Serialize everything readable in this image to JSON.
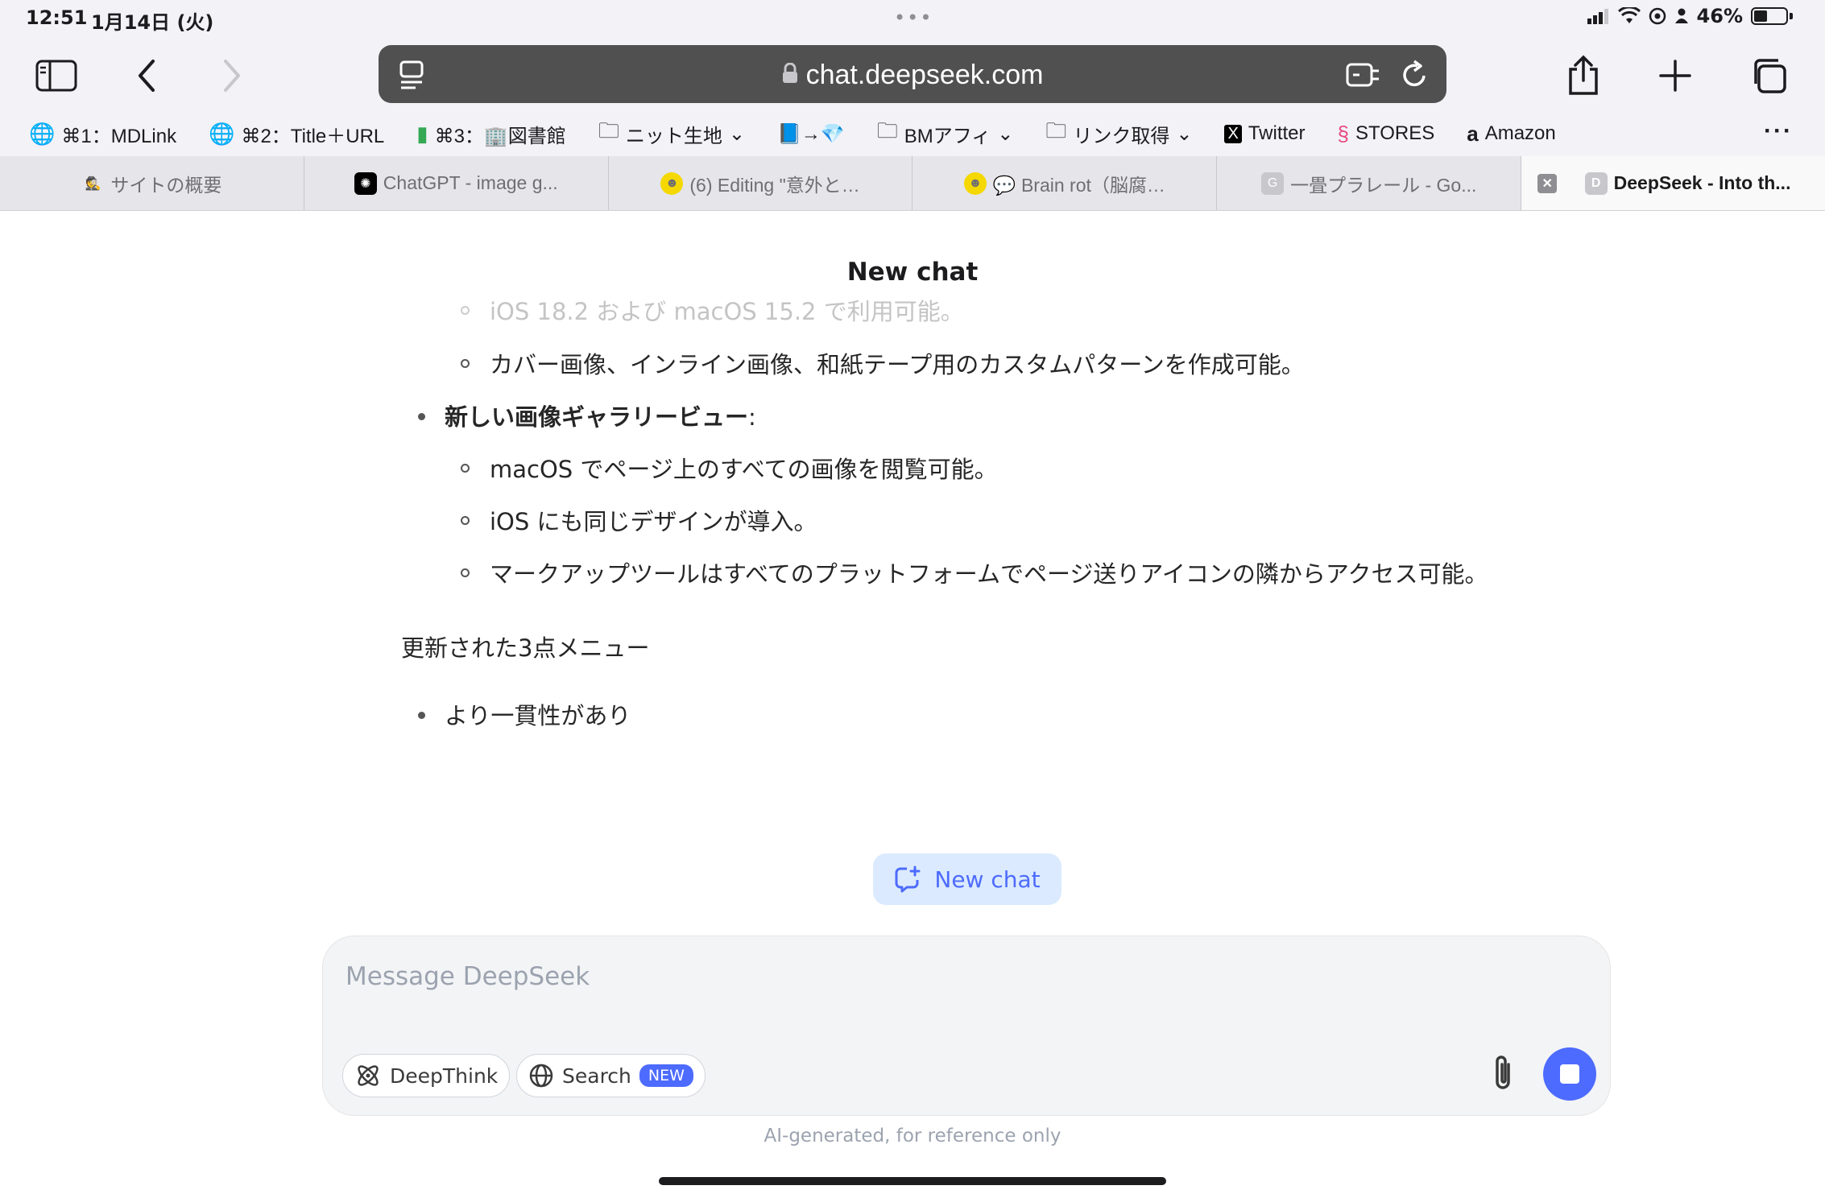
{
  "status": {
    "time": "12:51",
    "date": "1月14日 (火)",
    "dots": "•••",
    "battery_pct": "46%"
  },
  "toolbar": {
    "url": "chat.deepseek.com"
  },
  "bookmarks": [
    {
      "icon": "globe-icon",
      "label": "⌘1：MDLink"
    },
    {
      "icon": "globe-icon",
      "label": "⌘2：Title＋URL"
    },
    {
      "icon": "book-icon",
      "label": "⌘3：🏢図書館"
    },
    {
      "icon": "folder-icon",
      "label": "ニット生地"
    },
    {
      "icon": "book-arrow-gem-icon",
      "label": "📘→💎"
    },
    {
      "icon": "folder-icon",
      "label": "BMアフィ"
    },
    {
      "icon": "folder-icon",
      "label": "リンク取得"
    },
    {
      "icon": "x-logo-icon",
      "label": "Twitter"
    },
    {
      "icon": "stores-icon",
      "label": "STORES"
    },
    {
      "icon": "amazon-icon",
      "label": "Amazon"
    }
  ],
  "tabs": [
    {
      "label": "サイトの概要",
      "active": false
    },
    {
      "label": "ChatGPT - image g...",
      "active": false
    },
    {
      "label": "(6) Editing \"意外と…",
      "active": false
    },
    {
      "label": "💬 Brain rot（脳腐…",
      "active": false
    },
    {
      "label": "一畳プラレール - Go...",
      "active": false
    },
    {
      "label": "DeepSeek - Into th...",
      "active": true
    }
  ],
  "page": {
    "title": "New chat",
    "lines": [
      {
        "level": 2,
        "text": "iOS 18.2 および macOS 15.2 で利用可能。",
        "faded": true
      },
      {
        "level": 2,
        "text": "カバー画像、インライン画像、和紙テープ用のカスタムパターンを作成可能。"
      },
      {
        "level": 1,
        "text": "新しい画像ギャラリービュー",
        "suffix": ":",
        "bold": true
      },
      {
        "level": 2,
        "text": "macOS でページ上のすべての画像を閲覧可能。"
      },
      {
        "level": 2,
        "text": "iOS にも同じデザインが導入。"
      },
      {
        "level": 2,
        "text": "マークアップツールはすべてのプラットフォームでページ送りアイコンの隣からアクセス可能。"
      }
    ],
    "section_heading": "更新された3点メニュー",
    "section_items": [
      "より一貫性があり"
    ],
    "new_chat_button": "New chat"
  },
  "composer": {
    "placeholder": "Message DeepSeek",
    "deepthink_label": "DeepThink",
    "search_label": "Search",
    "search_badge": "NEW",
    "disclaimer": "AI-generated, for reference only"
  },
  "colors": {
    "accent": "#4d6bfe",
    "pill_bg": "#dbeafe"
  }
}
